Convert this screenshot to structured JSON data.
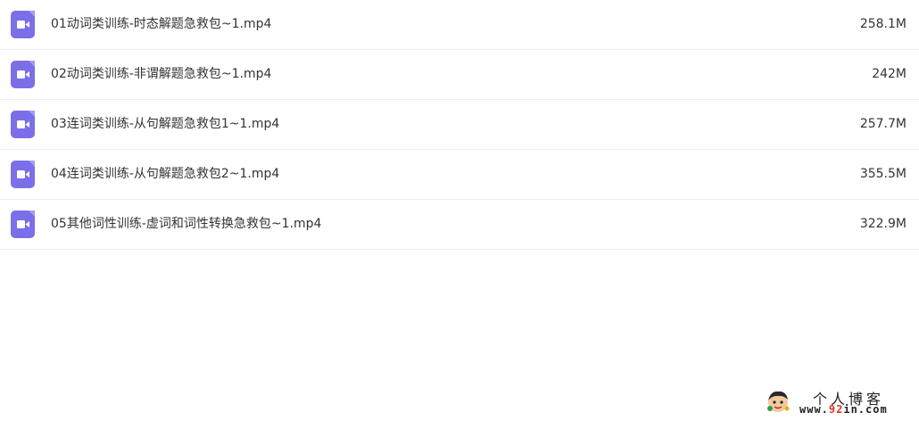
{
  "files": [
    {
      "name": "01动词类训练-时态解题急救包~1.mp4",
      "size": "258.1M",
      "icon": "video-file-icon"
    },
    {
      "name": "02动词类训练-非谓解题急救包~1.mp4",
      "size": "242M",
      "icon": "video-file-icon"
    },
    {
      "name": "03连词类训练-从句解题急救包1~1.mp4",
      "size": "257.7M",
      "icon": "video-file-icon"
    },
    {
      "name": "04连词类训练-从句解题急救包2~1.mp4",
      "size": "355.5M",
      "icon": "video-file-icon"
    },
    {
      "name": "05其他词性训练-虚词和词性转换急救包~1.mp4",
      "size": "322.9M",
      "icon": "video-file-icon"
    }
  ],
  "watermark": {
    "title": "个人博客",
    "url_prefix": "www.",
    "url_number": "92",
    "url_suffix": "in.com"
  },
  "colors": {
    "icon_fill": "#7b6fe8",
    "divider": "#eeeeee",
    "text": "#333333"
  }
}
